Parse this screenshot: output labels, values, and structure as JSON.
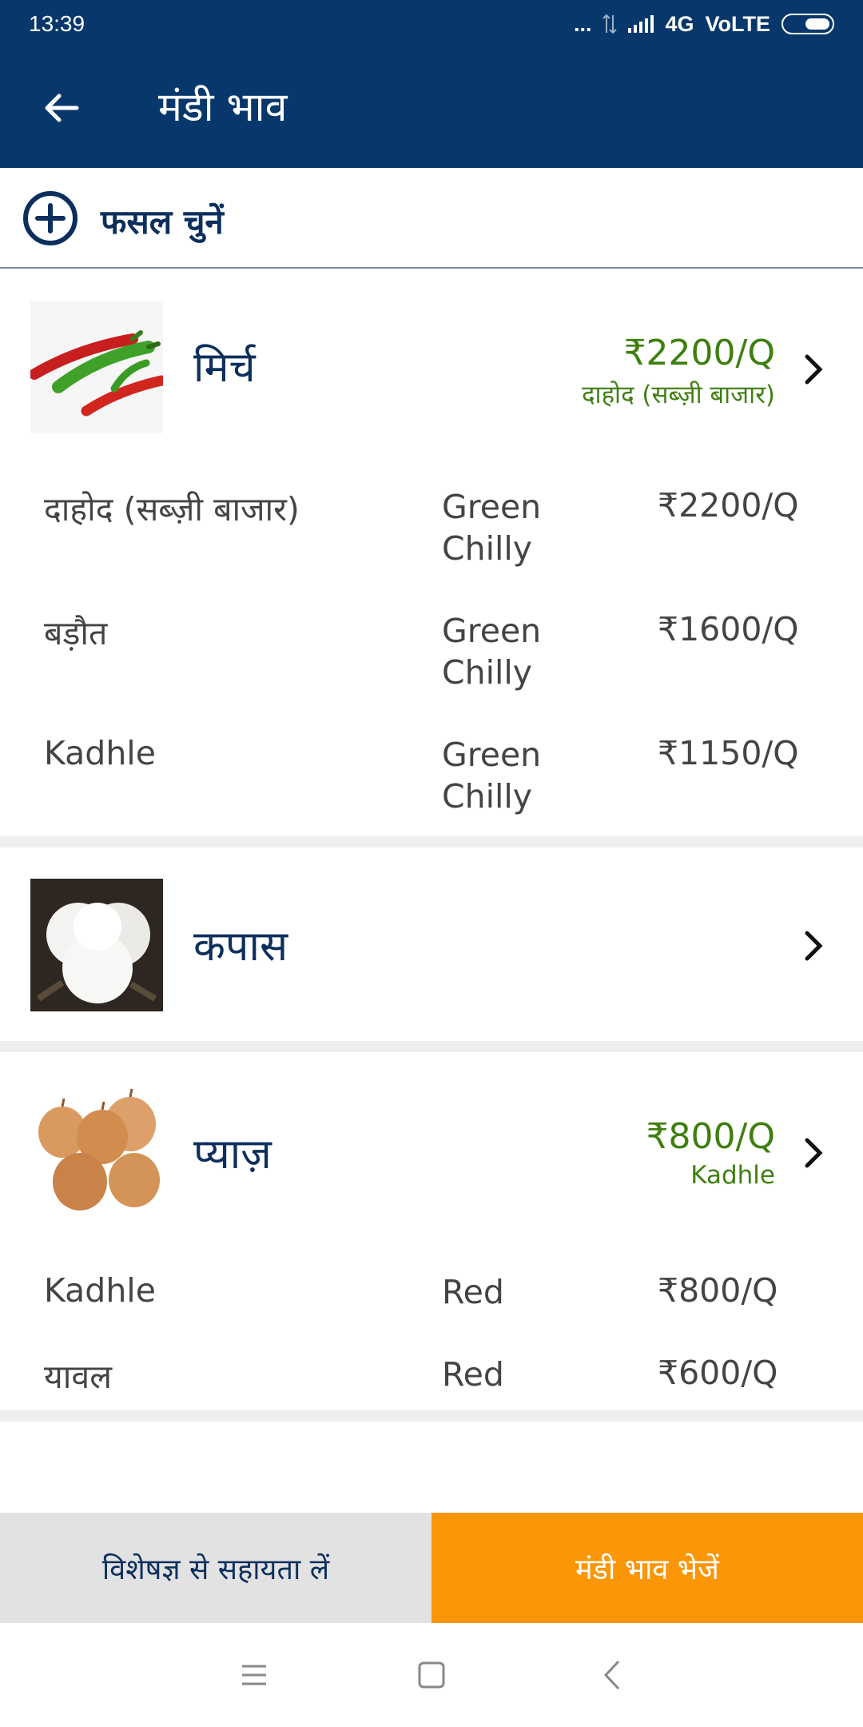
{
  "status_bar": {
    "time": "13:39",
    "dots": "...",
    "network": "4G",
    "volte": "VoLTE"
  },
  "app_bar": {
    "title": "मंडी भाव",
    "back_icon": "arrow-left-icon"
  },
  "select_crop": {
    "label": "फसल चुनें",
    "icon": "plus-circle-icon"
  },
  "crops": [
    {
      "name": "मिर्च",
      "image": "chilli-image",
      "best_price": "₹2200/Q",
      "best_market": "दाहोद (सब्ज़ी बाजार)",
      "rows": [
        {
          "market": "दाहोद (सब्ज़ी बाजार)",
          "variety": "Green Chilly",
          "price": "₹2200/Q"
        },
        {
          "market": "बड़ौत",
          "variety": "Green Chilly",
          "price": "₹1600/Q"
        },
        {
          "market": "Kadhle",
          "variety": "Green Chilly",
          "price": "₹1150/Q"
        }
      ]
    },
    {
      "name": "कपास",
      "image": "cotton-image",
      "best_price": "",
      "best_market": "",
      "rows": []
    },
    {
      "name": "प्याज़",
      "image": "onion-image",
      "best_price": "₹800/Q",
      "best_market": "Kadhle",
      "rows": [
        {
          "market": "Kadhle",
          "variety": "Red",
          "price": "₹800/Q"
        },
        {
          "market": "यावल",
          "variety": "Red",
          "price": "₹600/Q"
        }
      ]
    }
  ],
  "actions": {
    "expert_help": "विशेषज्ञ से सहायता लें",
    "send_price": "मंडी भाव भेजें"
  },
  "colors": {
    "primary": "#08386b",
    "accent": "#fb9606",
    "price_green": "#3f7f10",
    "title_blue": "#0c2f5d"
  }
}
